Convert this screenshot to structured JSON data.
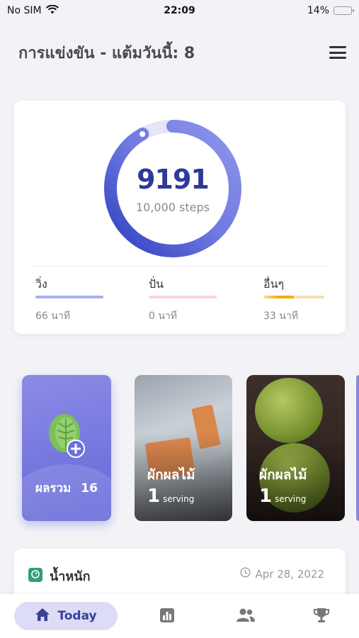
{
  "status": {
    "carrier": "No SIM",
    "time": "22:09",
    "battery": "14%",
    "battery_level": 0.14
  },
  "header": {
    "title": "การแข่งขัน - แต้มวันนี้: 8"
  },
  "steps": {
    "value": "9191",
    "goal_label": "10,000 steps",
    "progress": 0.9191
  },
  "activities": [
    {
      "label": "วิ่ง",
      "value": "66 นาที",
      "color": "#a9b0ec",
      "fill": 1.0
    },
    {
      "label": "ปั่น",
      "value": "0 นาที",
      "color": "#f8d5dc",
      "fill": 1.0
    },
    {
      "label": "อื่นๆ",
      "value": "33 นาที",
      "color": "#f6dfb0",
      "accent": "#f0b000",
      "fill": 0.5
    }
  ],
  "food_total": {
    "label": "ผลรวม",
    "value": "16"
  },
  "food_cards": [
    {
      "category": "ผักผลไม้",
      "count": "1",
      "unit": "serving"
    },
    {
      "category": "ผักผลไม้",
      "count": "1",
      "unit": "serving"
    }
  ],
  "weight": {
    "title": "น้ำหนัก",
    "date": "Apr 28, 2022"
  },
  "tabbar": {
    "today_label": "Today"
  },
  "colors": {
    "primary": "#2e3a9a",
    "ring": "#5a64d8",
    "tile": "#7a7ae2"
  }
}
